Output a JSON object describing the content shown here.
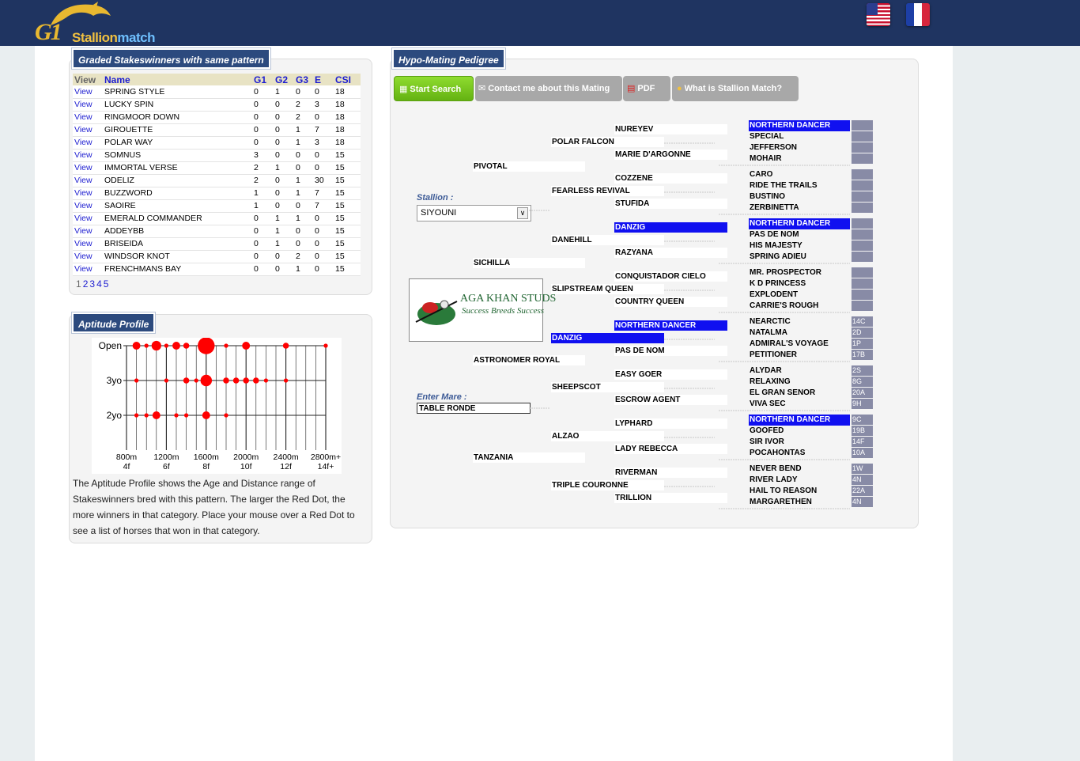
{
  "header": {
    "logo_text_g1": "G1",
    "logo_text_main": "Stallion",
    "logo_text_sub": "match",
    "flags": [
      "us-flag",
      "fr-flag"
    ]
  },
  "graded": {
    "title": "Graded Stakeswinners with same pattern",
    "columns": [
      "View",
      "Name",
      "G1",
      "G2",
      "G3",
      "E",
      "CSI"
    ],
    "rows": [
      [
        "View",
        "SPRING STYLE",
        "0",
        "1",
        "0",
        "0",
        "18"
      ],
      [
        "View",
        "LUCKY SPIN",
        "0",
        "0",
        "2",
        "3",
        "18"
      ],
      [
        "View",
        "RINGMOOR DOWN",
        "0",
        "0",
        "2",
        "0",
        "18"
      ],
      [
        "View",
        "GIROUETTE",
        "0",
        "0",
        "1",
        "7",
        "18"
      ],
      [
        "View",
        "POLAR WAY",
        "0",
        "0",
        "1",
        "3",
        "18"
      ],
      [
        "View",
        "SOMNUS",
        "3",
        "0",
        "0",
        "0",
        "15"
      ],
      [
        "View",
        "IMMORTAL VERSE",
        "2",
        "1",
        "0",
        "0",
        "15"
      ],
      [
        "View",
        "ODELIZ",
        "2",
        "0",
        "1",
        "30",
        "15"
      ],
      [
        "View",
        "BUZZWORD",
        "1",
        "0",
        "1",
        "7",
        "15"
      ],
      [
        "View",
        "SAOIRE",
        "1",
        "0",
        "0",
        "7",
        "15"
      ],
      [
        "View",
        "EMERALD COMMANDER",
        "0",
        "1",
        "1",
        "0",
        "15"
      ],
      [
        "View",
        "ADDEYBB",
        "0",
        "1",
        "0",
        "0",
        "15"
      ],
      [
        "View",
        "BRISEIDA",
        "0",
        "1",
        "0",
        "0",
        "15"
      ],
      [
        "View",
        "WINDSOR KNOT",
        "0",
        "0",
        "2",
        "0",
        "15"
      ],
      [
        "View",
        "FRENCHMANS BAY",
        "0",
        "0",
        "1",
        "0",
        "15"
      ]
    ],
    "pages": [
      "1",
      "2",
      "3",
      "4",
      "5"
    ]
  },
  "aptitude": {
    "title": "Aptitude Profile",
    "description": "The Aptitude Profile shows the Age and Distance range of Stakeswinners bred with this pattern. The larger the Red Dot, the more winners in that category. Place your mouse over a Red Dot to see a list of horses that won in that category.",
    "dot_color": "#ff0000"
  },
  "chart_data": {
    "type": "scatter",
    "title": "",
    "y_categories": [
      "Open",
      "3yo",
      "2yo"
    ],
    "x_tick_labels": [
      {
        "top": "800m",
        "bottom": "4f"
      },
      {
        "top": "1200m",
        "bottom": "6f"
      },
      {
        "top": "1600m",
        "bottom": "8f"
      },
      {
        "top": "2000m",
        "bottom": "10f"
      },
      {
        "top": "2400m",
        "bottom": "12f"
      },
      {
        "top": "2800m+",
        "bottom": "14f+"
      }
    ],
    "xlim": [
      800,
      2800
    ],
    "grid": true,
    "points": [
      {
        "x": 900,
        "y": "Open",
        "size": 3
      },
      {
        "x": 1000,
        "y": "Open",
        "size": 1
      },
      {
        "x": 1100,
        "y": "Open",
        "size": 4
      },
      {
        "x": 1200,
        "y": "Open",
        "size": 1
      },
      {
        "x": 1300,
        "y": "Open",
        "size": 3
      },
      {
        "x": 1400,
        "y": "Open",
        "size": 2
      },
      {
        "x": 1600,
        "y": "Open",
        "size": 8
      },
      {
        "x": 1800,
        "y": "Open",
        "size": 1
      },
      {
        "x": 2000,
        "y": "Open",
        "size": 3
      },
      {
        "x": 2400,
        "y": "Open",
        "size": 2
      },
      {
        "x": 2800,
        "y": "Open",
        "size": 1
      },
      {
        "x": 900,
        "y": "3yo",
        "size": 1
      },
      {
        "x": 1200,
        "y": "3yo",
        "size": 1
      },
      {
        "x": 1400,
        "y": "3yo",
        "size": 2
      },
      {
        "x": 1500,
        "y": "3yo",
        "size": 1
      },
      {
        "x": 1600,
        "y": "3yo",
        "size": 5
      },
      {
        "x": 1800,
        "y": "3yo",
        "size": 2
      },
      {
        "x": 1900,
        "y": "3yo",
        "size": 2
      },
      {
        "x": 2000,
        "y": "3yo",
        "size": 2
      },
      {
        "x": 2100,
        "y": "3yo",
        "size": 2
      },
      {
        "x": 2200,
        "y": "3yo",
        "size": 1
      },
      {
        "x": 2400,
        "y": "3yo",
        "size": 1
      },
      {
        "x": 900,
        "y": "2yo",
        "size": 1
      },
      {
        "x": 1000,
        "y": "2yo",
        "size": 1
      },
      {
        "x": 1100,
        "y": "2yo",
        "size": 3
      },
      {
        "x": 1300,
        "y": "2yo",
        "size": 1
      },
      {
        "x": 1400,
        "y": "2yo",
        "size": 1
      },
      {
        "x": 1600,
        "y": "2yo",
        "size": 3
      },
      {
        "x": 1800,
        "y": "2yo",
        "size": 1
      }
    ]
  },
  "hypo": {
    "title": "Hypo-Mating Pedigree",
    "buttons": {
      "start": "Start Search",
      "contact": "Contact me about this Mating",
      "pdf": "PDF",
      "what": "What is Stallion Match?"
    },
    "stallion_label": "Stallion :",
    "stallion_value": "SIYOUNI",
    "mare_label": "Enter Mare :",
    "mare_value": "TABLE RONDE",
    "ad": {
      "title": "AGA KHAN STUDS",
      "tagline": "Success Breeds Success"
    },
    "gen1": [
      "PIVOTAL",
      "SICHILLA",
      "ASTRONOMER ROYAL",
      "TANZANIA"
    ],
    "gen2": [
      "POLAR FALCON",
      "FEARLESS REVIVAL",
      "DANEHILL",
      "SLIPSTREAM QUEEN",
      "DANZIG",
      "SHEEPSCOT",
      "ALZAO",
      "TRIPLE COURONNE"
    ],
    "gen3": [
      "NUREYEV",
      "MARIE D'ARGONNE",
      "COZZENE",
      "STUFIDA",
      "DANZIG",
      "RAZYANA",
      "CONQUISTADOR CIELO",
      "COUNTRY QUEEN",
      "NORTHERN DANCER",
      "PAS DE NOM",
      "EASY GOER",
      "ESCROW AGENT",
      "LYPHARD",
      "LADY REBECCA",
      "RIVERMAN",
      "TRILLION"
    ],
    "gen4": [
      "NORTHERN DANCER",
      "SPECIAL",
      "JEFFERSON",
      "MOHAIR",
      "CARO",
      "RIDE THE TRAILS",
      "BUSTINO",
      "ZERBINETTA",
      "NORTHERN DANCER",
      "PAS DE NOM",
      "HIS MAJESTY",
      "SPRING ADIEU",
      "MR. PROSPECTOR",
      "K D PRINCESS",
      "EXPLODENT",
      "CARRIE'S ROUGH",
      "NEARCTIC",
      "NATALMA",
      "ADMIRAL'S VOYAGE",
      "PETITIONER",
      "ALYDAR",
      "RELAXING",
      "EL GRAN SENOR",
      "VIVA SEC",
      "NORTHERN DANCER",
      "GOOFED",
      "SIR IVOR",
      "POCAHONTAS",
      "NEVER BEND",
      "RIVER LADY",
      "HAIL TO REASON",
      "MARGARETHEN"
    ],
    "families": [
      "",
      "",
      "",
      "",
      "",
      "",
      "",
      "",
      "",
      "",
      "",
      "",
      "",
      "",
      "",
      "",
      "14C",
      "2D",
      "1P",
      "17B",
      "2S",
      "8G",
      "20A",
      "9H",
      "9C",
      "19B",
      "14F",
      "10A",
      "1W",
      "4N",
      "22A",
      "4N"
    ],
    "highlight_color": "#1010f0"
  }
}
